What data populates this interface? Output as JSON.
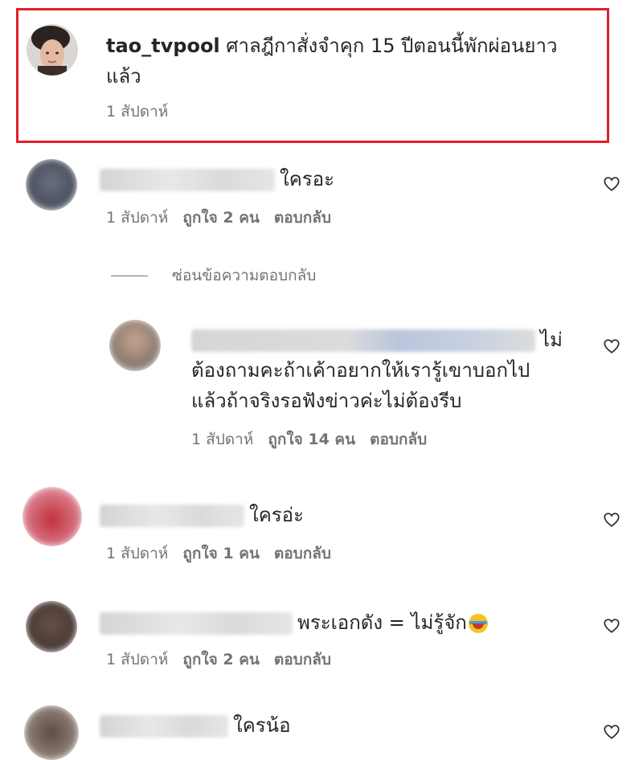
{
  "post": {
    "username": "tao_tvpool",
    "text": "ศาลฎีกาสั่งจำคุก 15 ปีตอนนี้พักผ่อนยาว",
    "text_line2": "แล้ว",
    "time": "1 สัปดาห์"
  },
  "comments": [
    {
      "text": "ใครอะ",
      "time": "1 สัปดาห์",
      "likes": "ถูกใจ 2 คน",
      "reply": "ตอบกลับ"
    },
    {
      "text": "ใครอ่ะ",
      "time": "1 สัปดาห์",
      "likes": "ถูกใจ 1 คน",
      "reply": "ตอบกลับ"
    },
    {
      "text": "พระเอกดัง = ไม่รู้จัก",
      "time": "1 สัปดาห์",
      "likes": "ถูกใจ 2 คน",
      "reply": "ตอบกลับ"
    },
    {
      "text": "ใครน้อ"
    }
  ],
  "replies_toggle": "ซ่อนข้อความตอบกลับ",
  "reply_comment": {
    "line1_end": "ไม่",
    "line2": "ต้องถามคะถ้าเค้าอยากให้เรารู้เขาบอกไป",
    "line3": "แล้วถ้าจริงรอฟังข่าวค่ะไม่ต้องรีบ",
    "time": "1 สัปดาห์",
    "likes": "ถูกใจ 14 คน",
    "reply": "ตอบกลับ"
  },
  "icons": {
    "heart": "heart-outline-icon",
    "emoji": "rolling-laughing-emoji"
  },
  "colors": {
    "highlight_border": "#e0202a",
    "meta_text": "#737373",
    "primary_text": "#262626"
  }
}
